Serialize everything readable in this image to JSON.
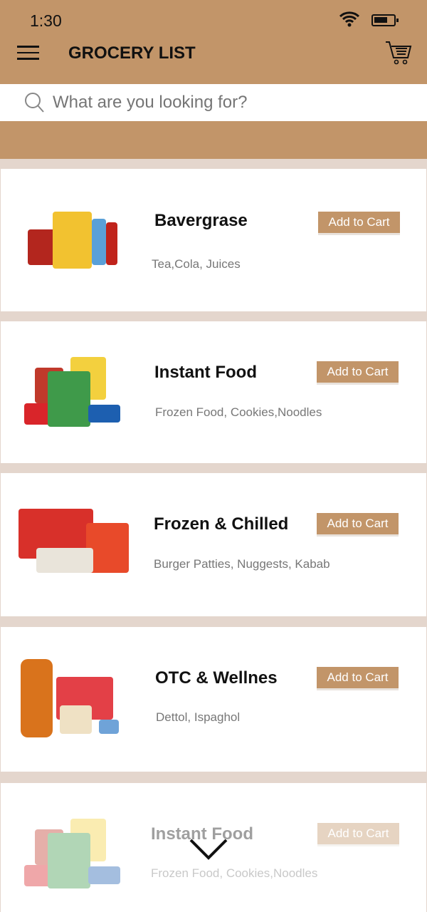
{
  "status": {
    "time": "1:30"
  },
  "header": {
    "title": "GROCERY LIST"
  },
  "search": {
    "placeholder": "What are you looking for?"
  },
  "categories": [
    {
      "name": "Bavergrase",
      "items": "Tea,Cola, Juices",
      "button": "Add to Cart"
    },
    {
      "name": "Instant Food",
      "items": "Frozen Food, Cookies,Noodles",
      "button": "Add to Cart"
    },
    {
      "name": "Frozen & Chilled",
      "items": "Burger Patties, Nuggests, Kabab",
      "button": "Add to Cart"
    },
    {
      "name": "OTC & Wellnes",
      "items": "Dettol, Ispaghol",
      "button": "Add to Cart"
    },
    {
      "name": "Instant Food",
      "items": "Frozen Food, Cookies,Noodles",
      "button": "Add to Cart"
    }
  ],
  "colors": {
    "brand": "#c29569",
    "gap": "#e4d6cd"
  }
}
